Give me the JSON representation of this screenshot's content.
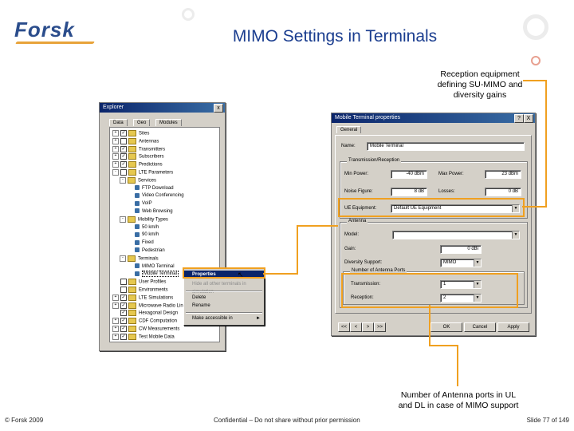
{
  "header": {
    "logo": "Forsk",
    "title": "MIMO Settings in Terminals"
  },
  "callouts": {
    "top_right": [
      "Reception equipment",
      "defining SU-MIMO and",
      "diversity gains"
    ],
    "bottom": [
      "Number of Antenna ports in UL",
      "and DL in case of MIMO support"
    ]
  },
  "footer": {
    "copyright": "© Forsk 2009",
    "confidential": "Confidential – Do not share without prior permission",
    "slide": "Slide 77 of 149"
  },
  "explorer": {
    "title": "Explorer",
    "close": "x",
    "tabs": [
      "Data",
      "Geo",
      "Modules"
    ],
    "tree": [
      {
        "indent": 0,
        "expander": "+",
        "check": true,
        "icon": "folder",
        "label": "Sites"
      },
      {
        "indent": 0,
        "expander": "+",
        "check": false,
        "icon": "folder",
        "label": "Antennas"
      },
      {
        "indent": 0,
        "expander": "+",
        "check": true,
        "icon": "folder",
        "label": "Transmitters"
      },
      {
        "indent": 0,
        "expander": "+",
        "check": true,
        "icon": "folder",
        "label": "Subscribers"
      },
      {
        "indent": 0,
        "expander": "+",
        "check": true,
        "icon": "folder",
        "label": "Predictions"
      },
      {
        "indent": 0,
        "expander": "-",
        "check": false,
        "icon": "folder",
        "label": "LTE Parameters"
      },
      {
        "indent": 1,
        "expander": "-",
        "check": false,
        "icon": "folder",
        "label": "Services"
      },
      {
        "indent": 2,
        "expander": "",
        "check": false,
        "icon": "leaf",
        "label": "FTP Download"
      },
      {
        "indent": 2,
        "expander": "",
        "check": false,
        "icon": "leaf",
        "label": "Video Conferencing"
      },
      {
        "indent": 2,
        "expander": "",
        "check": false,
        "icon": "leaf",
        "label": "VoIP"
      },
      {
        "indent": 2,
        "expander": "",
        "check": false,
        "icon": "leaf",
        "label": "Web Browsing"
      },
      {
        "indent": 1,
        "expander": "-",
        "check": false,
        "icon": "folder",
        "label": "Mobility Types"
      },
      {
        "indent": 2,
        "expander": "",
        "check": false,
        "icon": "leaf",
        "label": "50 km/h"
      },
      {
        "indent": 2,
        "expander": "",
        "check": false,
        "icon": "leaf",
        "label": "90 km/h"
      },
      {
        "indent": 2,
        "expander": "",
        "check": false,
        "icon": "leaf",
        "label": "Fixed"
      },
      {
        "indent": 2,
        "expander": "",
        "check": false,
        "icon": "leaf",
        "label": "Pedestrian"
      },
      {
        "indent": 1,
        "expander": "-",
        "check": false,
        "icon": "folder",
        "label": "Terminals"
      },
      {
        "indent": 2,
        "expander": "",
        "check": false,
        "icon": "leaf",
        "label": "MIMO Terminal"
      },
      {
        "indent": 2,
        "expander": "",
        "check": false,
        "icon": "leaf",
        "label": "Mobile Terminal",
        "selected": true
      },
      {
        "indent": 0,
        "expander": "",
        "check": false,
        "icon": "folder",
        "label": "User Profiles"
      },
      {
        "indent": 0,
        "expander": "",
        "check": false,
        "icon": "folder",
        "label": "Environments"
      },
      {
        "indent": 0,
        "expander": "+",
        "check": true,
        "icon": "folder",
        "label": "LTE Simulations"
      },
      {
        "indent": 0,
        "expander": "+",
        "check": true,
        "icon": "folder",
        "label": "Microwave Radio Links"
      },
      {
        "indent": 0,
        "expander": "",
        "check": true,
        "icon": "folder",
        "label": "Hexagonal Design"
      },
      {
        "indent": 0,
        "expander": "+",
        "check": true,
        "icon": "folder",
        "label": "CDF Computation"
      },
      {
        "indent": 0,
        "expander": "+",
        "check": true,
        "icon": "folder",
        "label": "CW Measurements"
      },
      {
        "indent": 0,
        "expander": "+",
        "check": true,
        "icon": "folder",
        "label": "Test Mobile Data"
      }
    ]
  },
  "context_menu": {
    "items": [
      {
        "label": "Properties",
        "state": "selected"
      },
      {
        "label": "Hide all other terminals in simulation",
        "state": "disabled"
      },
      {
        "label": "Delete",
        "state": "normal"
      },
      {
        "label": "Rename",
        "state": "normal"
      },
      {
        "label": "Make accessible in",
        "state": "normal",
        "submenu": "►"
      }
    ]
  },
  "props": {
    "title": "Mobile Terminal properties",
    "title_buttons": [
      "?",
      "X"
    ],
    "tab": "General",
    "name_label": "Name:",
    "name_value": "Mobile Terminal",
    "tx_group": "Transmission/Reception",
    "min_power_label": "Min Power:",
    "min_power_value": "-40 dBm",
    "max_power_label": "Max Power:",
    "max_power_value": "23 dBm",
    "noise_figure_label": "Noise Figure:",
    "noise_figure_value": "8 dB",
    "losses_label": "Losses:",
    "losses_value": "0 dB",
    "ue_label": "UE Equipment:",
    "ue_value": "Default UE Equipment",
    "antenna_group": "Antenna",
    "model_label": "Model:",
    "model_value": "",
    "gain_label": "Gain:",
    "gain_value": "0 dBi",
    "diversity_label": "Diversity Support:",
    "diversity_value": "MIMO",
    "ports_group": "Number of Antenna Ports",
    "tx_ports_label": "Transmission:",
    "tx_ports_value": "1",
    "rx_ports_label": "Reception:",
    "rx_ports_value": "2",
    "nav_buttons": [
      "<<",
      "<",
      ">",
      ">>"
    ],
    "ok": "OK",
    "cancel": "Cancel",
    "apply": "Apply"
  }
}
